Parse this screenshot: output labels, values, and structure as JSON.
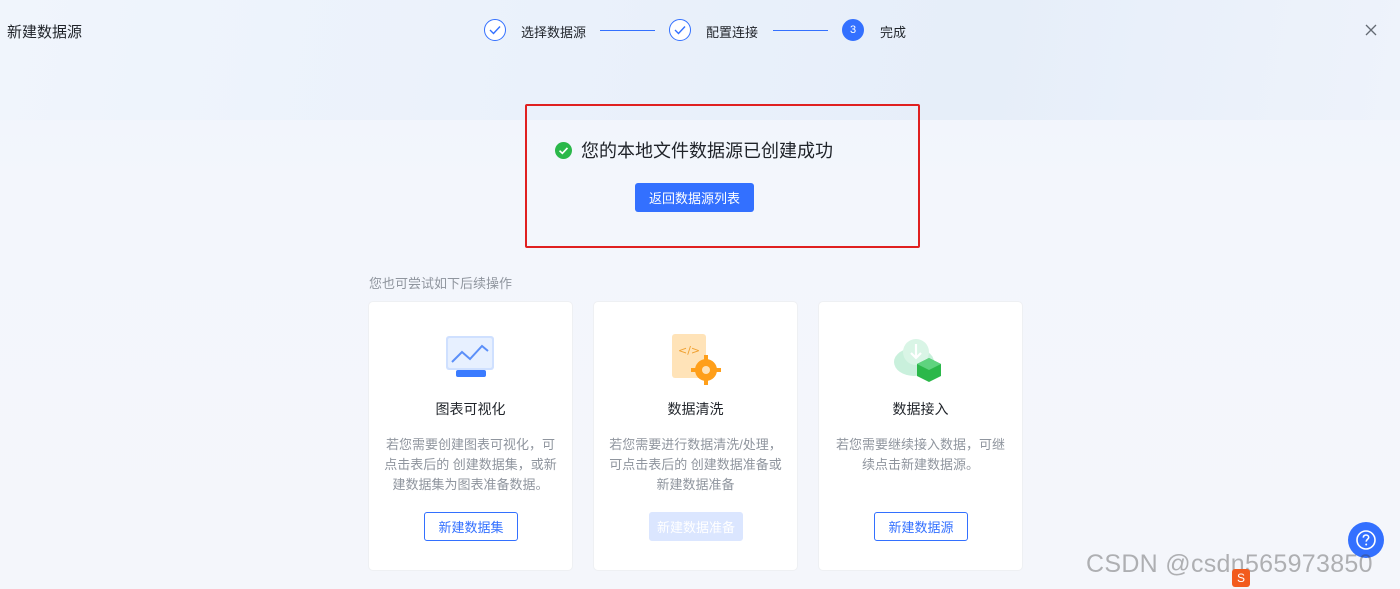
{
  "header": {
    "title": "新建数据源"
  },
  "steps": [
    {
      "label": "选择数据源",
      "state": "done"
    },
    {
      "label": "配置连接",
      "state": "done"
    },
    {
      "label": "完成",
      "number": "3",
      "state": "active"
    }
  ],
  "success": {
    "message": "您的本地文件数据源已创建成功",
    "button_label": "返回数据源列表"
  },
  "hint": "您也可尝试如下后续操作",
  "cards": [
    {
      "icon": "chart-visualization-icon",
      "title": "图表可视化",
      "desc": "若您需要创建图表可视化，可点击表后的 创建数据集，或新建数据集为图表准备数据。",
      "button_label": "新建数据集",
      "disabled": false
    },
    {
      "icon": "data-cleaning-icon",
      "title": "数据清洗",
      "desc": "若您需要进行数据清洗/处理，可点击表后的 创建数据准备或新建数据准备",
      "button_label": "新建数据准备",
      "disabled": true
    },
    {
      "icon": "data-ingest-icon",
      "title": "数据接入",
      "desc": "若您需要继续接入数据，可继续点击新建数据源。",
      "button_label": "新建数据源",
      "disabled": false
    }
  ],
  "watermark": "CSDN @csdn565973850",
  "colors": {
    "primary": "#3370ff",
    "success": "#2bb84a",
    "highlight_border": "#e02020"
  }
}
